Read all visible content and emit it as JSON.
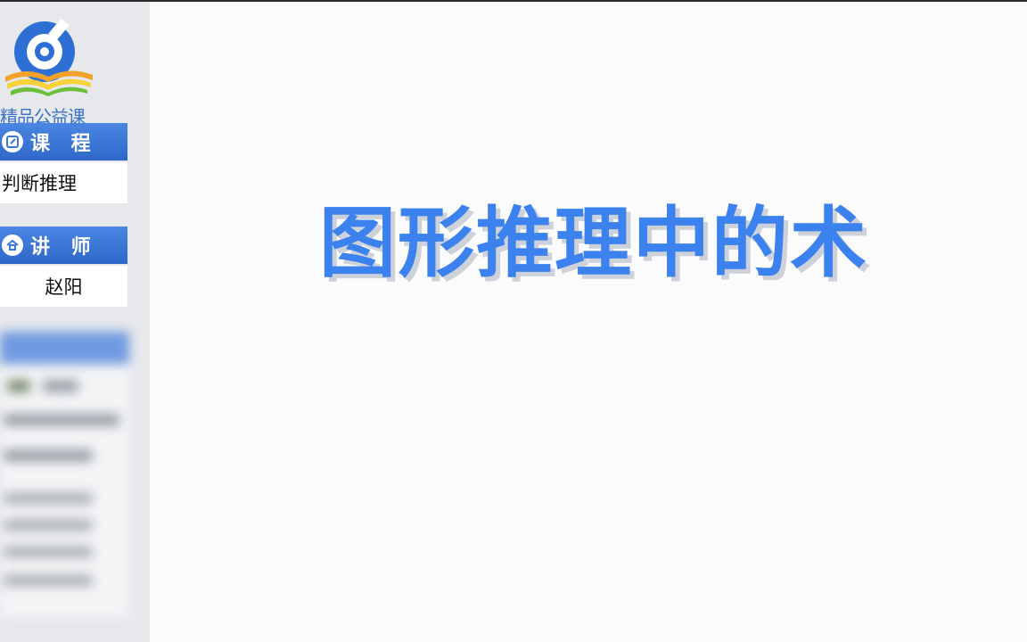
{
  "sidebar": {
    "logo": {
      "text": "精品公益课",
      "colors": {
        "ring": "#2e6fd6",
        "book_orange": "#f2a22a",
        "book_yellow": "#f7d23a",
        "book_green": "#6bbf3a"
      }
    },
    "course": {
      "header": "课 程",
      "icon": "edit-icon",
      "value": "判断推理"
    },
    "teacher": {
      "header": "讲 师",
      "icon": "teacher-icon",
      "value": "赵阳"
    }
  },
  "main": {
    "title": "图形推理中的术"
  },
  "colors": {
    "accent": "#3b82ee",
    "header_blue": "#3a78d8",
    "sidebar_bg": "#e6e8ec"
  }
}
